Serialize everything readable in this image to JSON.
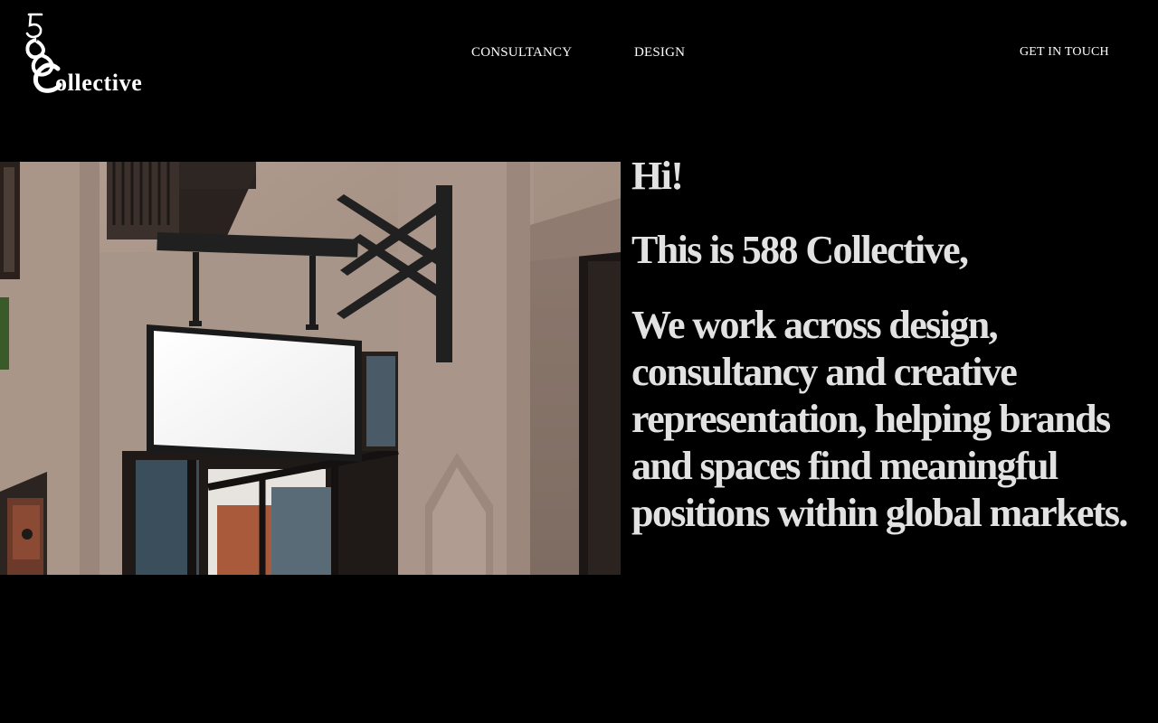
{
  "brand": {
    "logo_text": "588 Collective",
    "logo_icon": "588-collective-monogram"
  },
  "nav": {
    "items": [
      {
        "label": "CONSULTANCY"
      },
      {
        "label": "DESIGN"
      }
    ],
    "cta_label": "GET IN TOUCH"
  },
  "hero": {
    "image_alt": "blank-hanging-storefront-sign-photo",
    "greeting": "Hi!",
    "intro": "This is 588 Collective,",
    "body": "We work across design, consultancy and creative representation, helping brands and spaces find meaningful positions within global markets."
  },
  "colors": {
    "background": "#000000",
    "nav_text": "#ffffff",
    "headline_text": "#e2e2e2"
  }
}
